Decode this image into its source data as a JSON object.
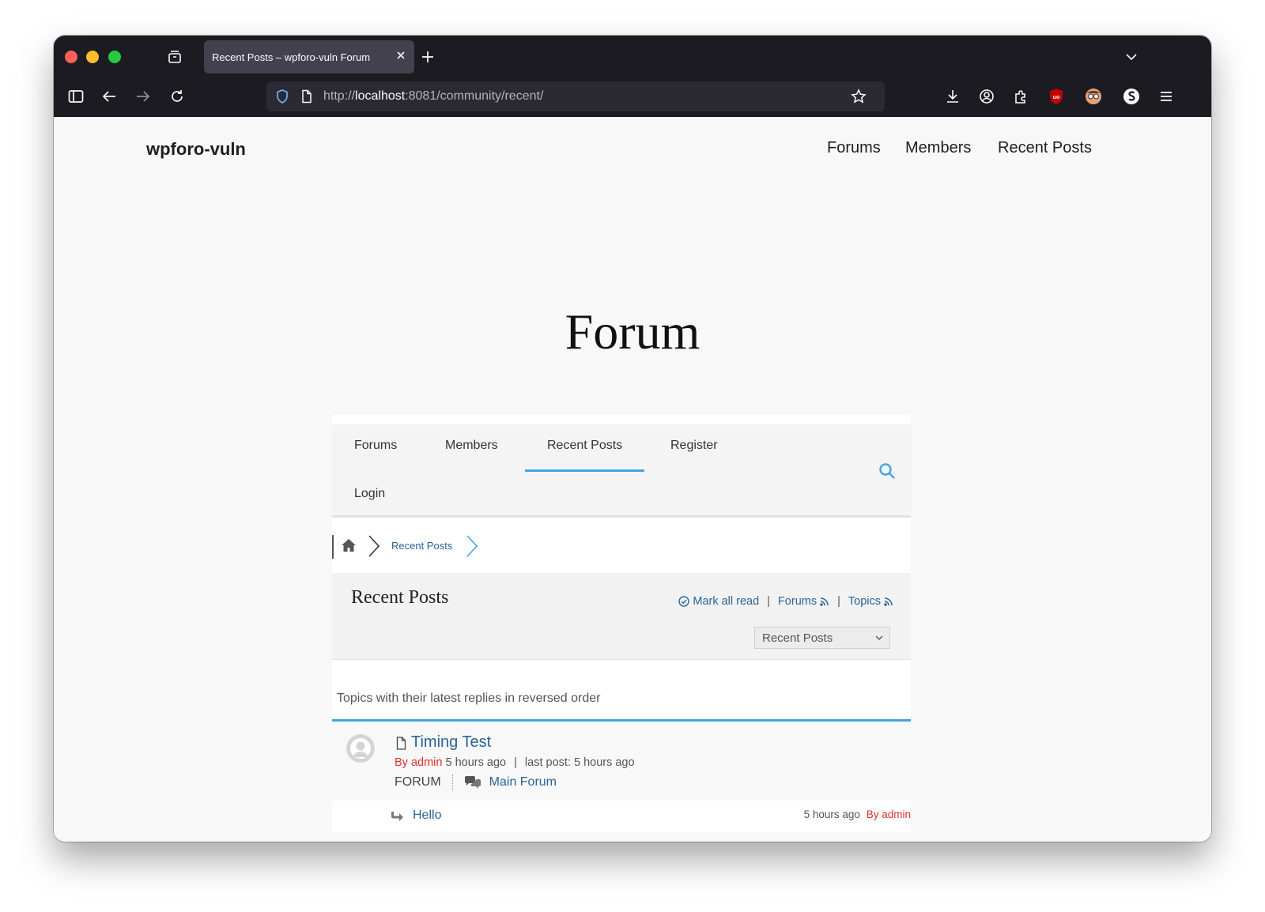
{
  "browser": {
    "tab_title": "Recent Posts – wpforo-vuln Forum",
    "url_scheme": "http://",
    "url_host": "localhost",
    "url_rest": ":8081/community/recent/"
  },
  "site": {
    "title": "wpforo-vuln",
    "nav": [
      "Forums",
      "Members",
      "Recent Posts"
    ]
  },
  "hero_title": "Forum",
  "forum_menu": {
    "items": [
      "Forums",
      "Members",
      "Recent Posts",
      "Register",
      "Login"
    ],
    "active": "Recent Posts"
  },
  "breadcrumb": {
    "current": "Recent Posts"
  },
  "section": {
    "title": "Recent Posts",
    "mark_all_read": "Mark all read",
    "forums_feed": "Forums",
    "topics_feed": "Topics",
    "filter_selected": "Recent Posts",
    "description": "Topics with their latest replies in reversed order"
  },
  "topics": [
    {
      "title": "Timing Test",
      "author_prefix": "By admin",
      "created": "5 hours ago",
      "last_post": "last post: 5 hours ago",
      "forum_label": "FORUM",
      "forum_name": "Main Forum",
      "reply": {
        "title": "Hello",
        "time": "5 hours ago",
        "author": "By admin"
      }
    }
  ],
  "colors": {
    "accent": "#43a6df",
    "link": "#2a6496",
    "author": "#e12f2f",
    "chrome_bg": "#1c1b22"
  }
}
